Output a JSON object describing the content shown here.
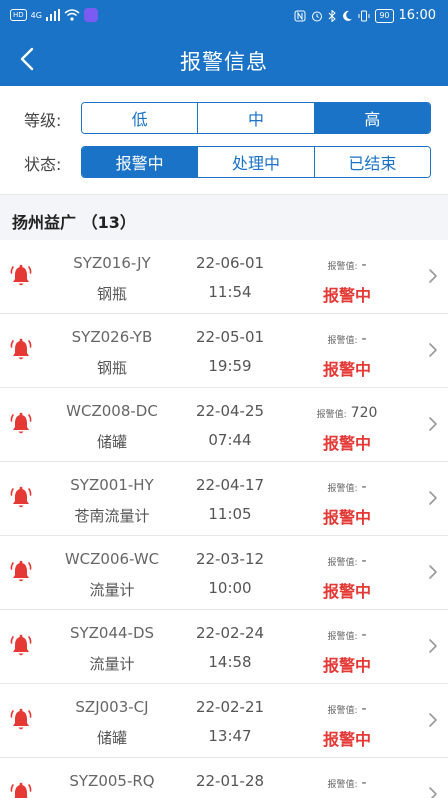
{
  "status_bar": {
    "hd": "HD",
    "network": "4G",
    "battery": "90",
    "time": "16:00"
  },
  "header": {
    "title": "报警信息"
  },
  "filters": {
    "level_label": "等级:",
    "level_options": [
      "低",
      "中",
      "高"
    ],
    "level_selected": "高",
    "state_label": "状态:",
    "state_options": [
      "报警中",
      "处理中",
      "已结束"
    ],
    "state_selected": "报警中"
  },
  "group": {
    "title": "扬州益广 （13）"
  },
  "alarm_value_label": "报警值:",
  "items": [
    {
      "code": "SYZ016-JY",
      "type": "钢瓶",
      "date": "22-06-01",
      "time": "11:54",
      "value": "-",
      "status": "报警中"
    },
    {
      "code": "SYZ026-YB",
      "type": "钢瓶",
      "date": "22-05-01",
      "time": "19:59",
      "value": "-",
      "status": "报警中"
    },
    {
      "code": "WCZ008-DC",
      "type": "储罐",
      "date": "22-04-25",
      "time": "07:44",
      "value": "720",
      "status": "报警中"
    },
    {
      "code": "SYZ001-HY",
      "type": "苍南流量计",
      "date": "22-04-17",
      "time": "11:05",
      "value": "-",
      "status": "报警中"
    },
    {
      "code": "WCZ006-WC",
      "type": "流量计",
      "date": "22-03-12",
      "time": "10:00",
      "value": "-",
      "status": "报警中"
    },
    {
      "code": "SYZ044-DS",
      "type": "流量计",
      "date": "22-02-24",
      "time": "14:58",
      "value": "-",
      "status": "报警中"
    },
    {
      "code": "SZJ003-CJ",
      "type": "储罐",
      "date": "22-02-21",
      "time": "13:47",
      "value": "-",
      "status": "报警中"
    },
    {
      "code": "SYZ005-RQ",
      "type": "",
      "date": "22-01-28",
      "time": "",
      "value": "-",
      "status": ""
    }
  ],
  "colors": {
    "primary": "#1a73c6",
    "alarm": "#e53935",
    "background": "#f4f5f8"
  }
}
